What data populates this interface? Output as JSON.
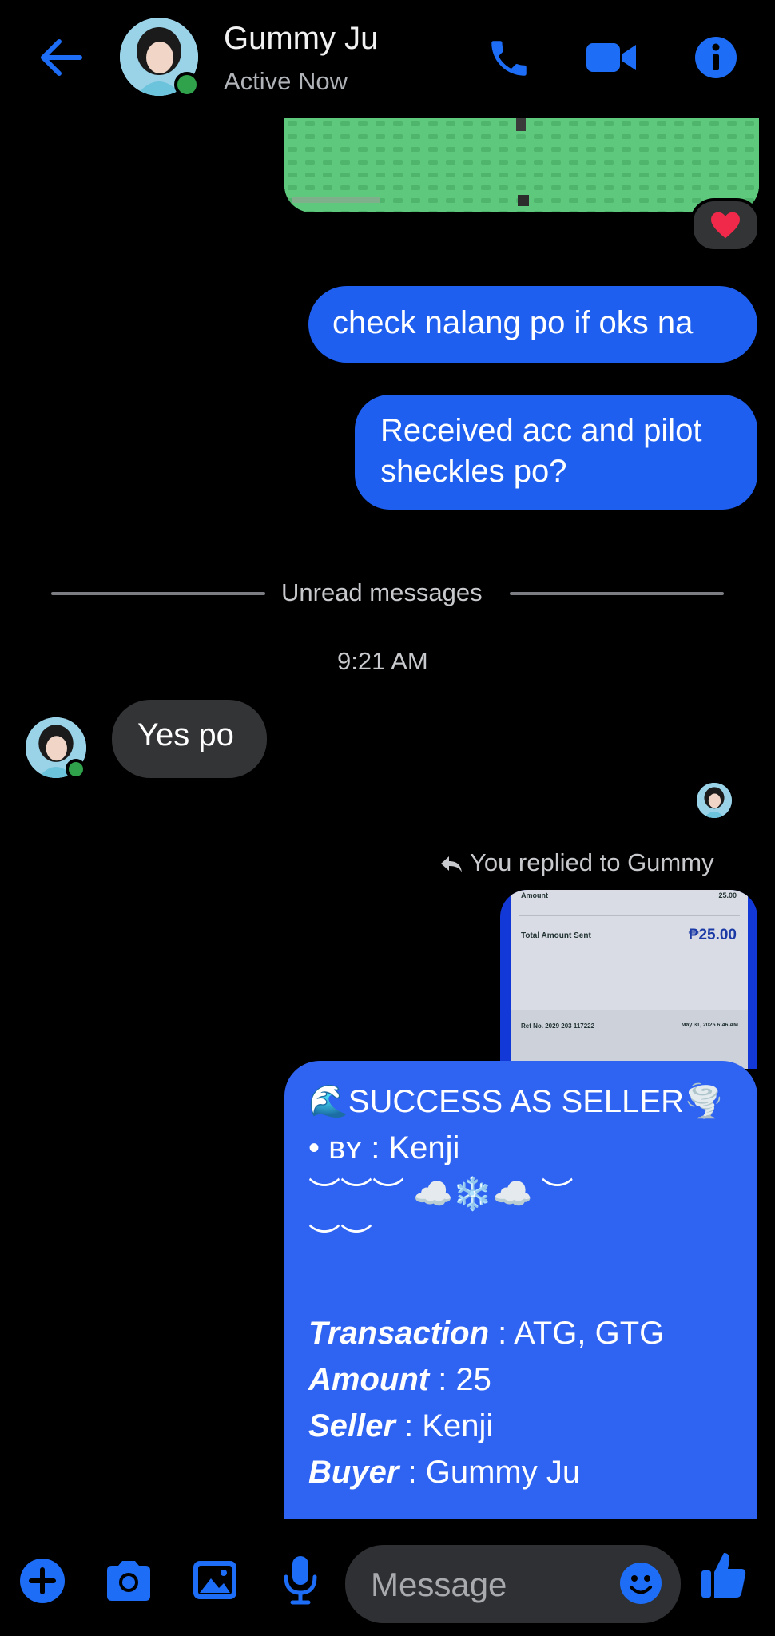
{
  "header": {
    "contact_name": "Gummy Ju",
    "status": "Active Now"
  },
  "messages": {
    "out1": "check nalang po if oks na",
    "out2_line1": "Received acc and pilot",
    "out2_line2": "sheckles po?",
    "unread_label": "Unread messages",
    "timestamp": "9:21 AM",
    "in1": "Yes po",
    "reply_label": "You replied to Gummy"
  },
  "receipt_preview": {
    "amount_label": "Amount",
    "amount_value": "25.00",
    "total_label": "Total Amount Sent",
    "total_value": "₱25.00",
    "ref_label": "Ref No. 2029 203 117222",
    "date": "May 31, 2025 6:46 AM"
  },
  "card": {
    "line1": "🌊SUCCESS AS SELLER🌪️",
    "line2_prefix": "• ʙʏ : ",
    "line2_value": "Kenji",
    "line3": "︶︶︶ ☁️❄️☁️ ︶",
    "line4": "︶︶",
    "transaction_label": "Transaction",
    "transaction_value": " : ATG, GTG",
    "amount_label": "Amount",
    "amount_value": " : 25",
    "seller_label": "Seller",
    "seller_value": " : Kenji",
    "buyer_label": "Buyer",
    "buyer_value": " : Gummy Ju"
  },
  "composer": {
    "placeholder": "Message"
  },
  "icons": {
    "back": "back-arrow-icon",
    "call": "phone-icon",
    "video": "video-camera-icon",
    "info": "info-icon",
    "reaction": "heart-icon",
    "plus": "plus-icon",
    "camera": "camera-icon",
    "gallery": "image-icon",
    "mic": "microphone-icon",
    "emoji": "emoji-icon",
    "like": "thumbs-up-icon"
  },
  "colors": {
    "accent": "#1d6df7",
    "outgoing_bubble": "#1e5ff0",
    "incoming_bubble": "#333436",
    "online": "#31a24c",
    "background": "#000000"
  }
}
